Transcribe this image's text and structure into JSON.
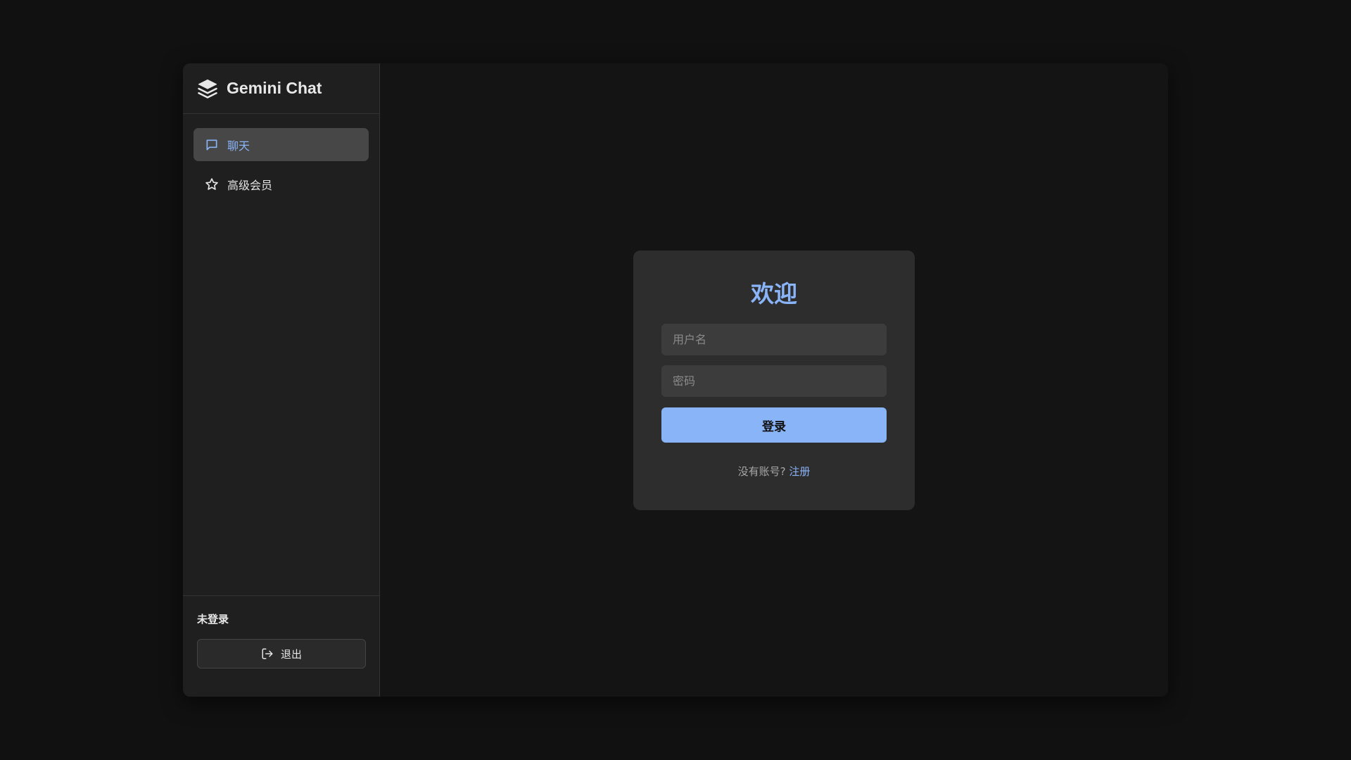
{
  "app": {
    "title": "Gemini Chat",
    "logo_icon": "layers-icon"
  },
  "sidebar": {
    "items": [
      {
        "label": "聊天",
        "icon": "chat-bubble-icon",
        "active": true
      },
      {
        "label": "高级会员",
        "icon": "star-icon",
        "active": false
      }
    ],
    "user_status": "未登录",
    "logout": {
      "label": "退出",
      "icon": "logout-icon"
    }
  },
  "login": {
    "title": "欢迎",
    "username_placeholder": "用户名",
    "username_value": "",
    "password_placeholder": "密码",
    "password_value": "",
    "submit_label": "登录",
    "signup_prompt": "没有账号?",
    "signup_link": "注册"
  },
  "colors": {
    "accent": "#8ab4f8",
    "background": "#111111",
    "sidebar": "#1f1f1f",
    "card": "#2d2d2d",
    "nav_active": "#474747"
  }
}
